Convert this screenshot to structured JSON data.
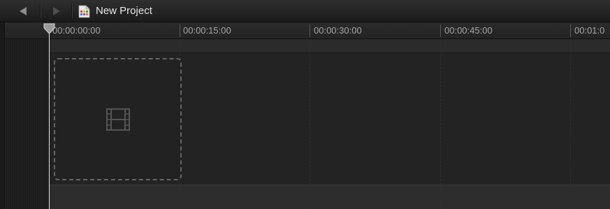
{
  "toolbar": {
    "back_icon": "back-arrow-icon",
    "forward_icon": "forward-arrow-icon",
    "project_icon": "project-document-icon",
    "project_title": "New Project"
  },
  "ruler": {
    "timecodes": [
      "00:00:00:00",
      "00:00:15:00",
      "00:00:30:00",
      "00:00:45:00",
      "00:01:0"
    ]
  },
  "timeline": {
    "drop_zone_icon": "film-strip-icon",
    "playhead_timecode": "00:00:00:00"
  },
  "colors": {
    "background": "#222222",
    "toolbar": "#262626",
    "playhead": "#e8e8e8",
    "ruler_text": "#a7a7a7",
    "title_text": "#e6e6e6",
    "drop_zone_border": "#666666"
  }
}
